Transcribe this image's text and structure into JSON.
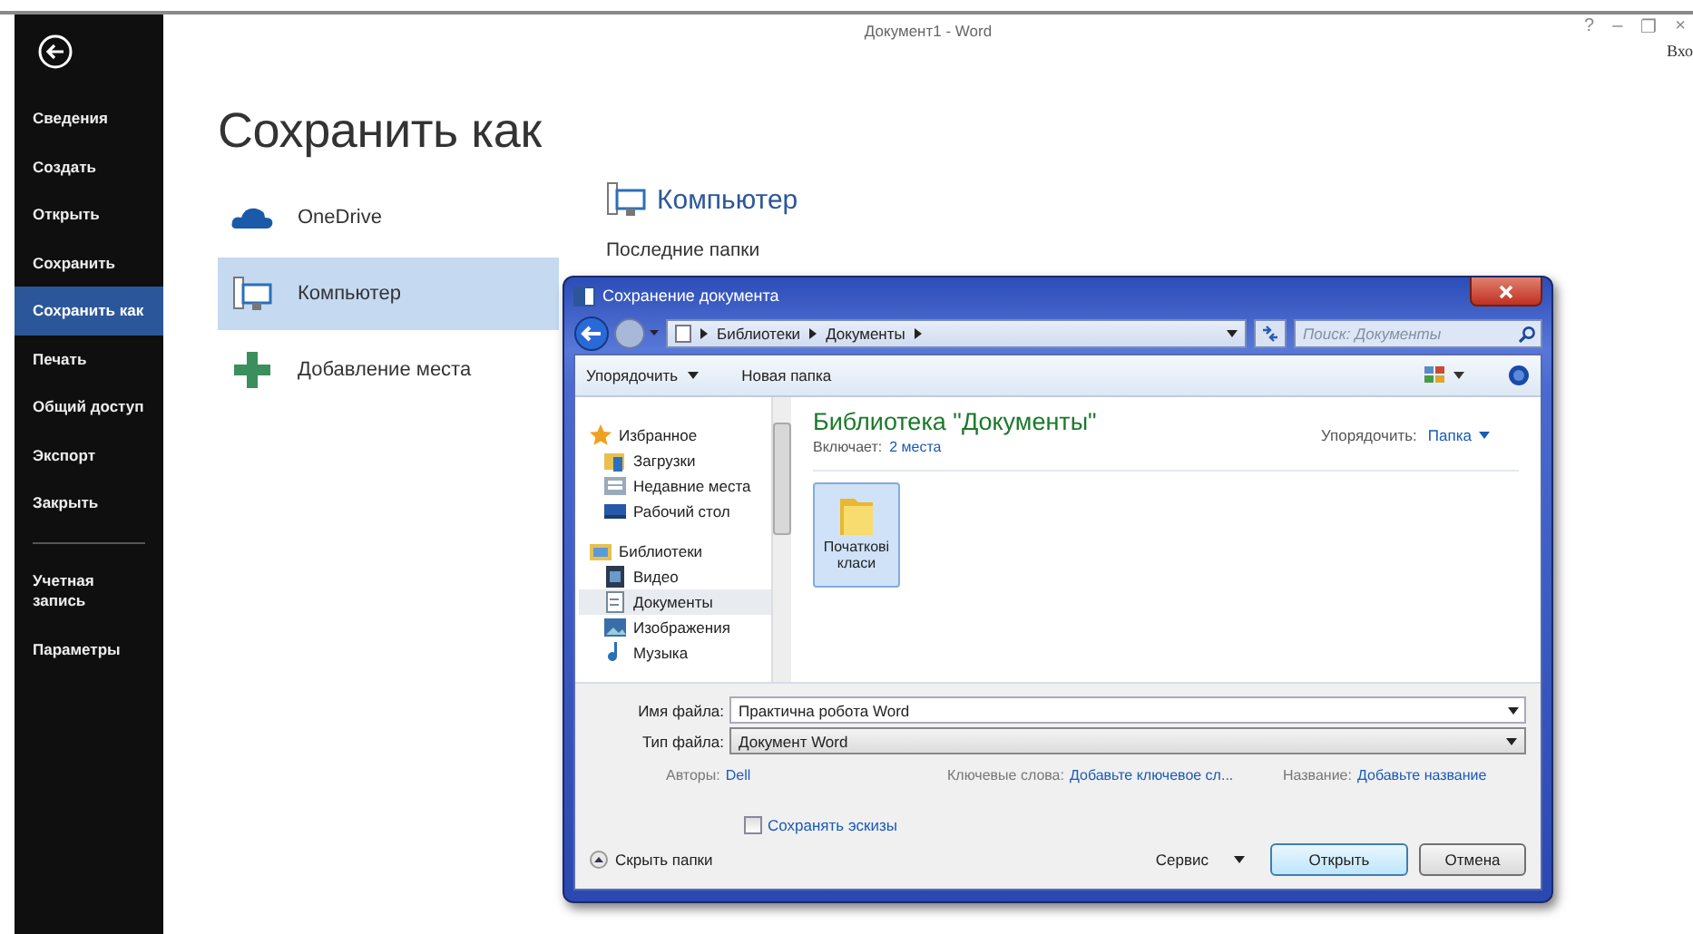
{
  "window": {
    "title": "Документ1 - Word",
    "controls": [
      "?",
      "–",
      "❐",
      "×"
    ],
    "sign_in": "Вхо"
  },
  "menu": [
    {
      "label": "Сведения",
      "selected": false
    },
    {
      "label": "Создать",
      "selected": false
    },
    {
      "label": "Открыть",
      "selected": false
    },
    {
      "label": "Сохранить",
      "selected": false
    },
    {
      "label": "Сохранить как",
      "selected": true
    },
    {
      "label": "Печать",
      "selected": false
    },
    {
      "label": "Общий доступ",
      "selected": false
    },
    {
      "label": "Экспорт",
      "selected": false
    },
    {
      "label": "Закрыть",
      "selected": false
    }
  ],
  "menu_bottom": [
    {
      "label": "Учетная запись",
      "selected": false
    },
    {
      "label": "Параметры",
      "selected": false
    }
  ],
  "heading": "Сохранить как",
  "places": [
    {
      "label": "OneDrive",
      "kind": "cloud",
      "selected": false
    },
    {
      "label": "Компьютер",
      "kind": "computer",
      "selected": true
    },
    {
      "label": "Добавление места",
      "kind": "plus",
      "selected": false
    }
  ],
  "location": {
    "title": "Компьютер",
    "recent_heading": "Последние папки"
  },
  "dialog": {
    "title": "Сохранение документа",
    "breadcrumb": [
      "Библиотеки",
      "Документы"
    ],
    "search_placeholder": "Поиск: Документы",
    "toolbar": {
      "organize": "Упорядочить",
      "new_folder": "Новая папка"
    },
    "nav": [
      {
        "label": "Избранное",
        "kind": "star",
        "selected": false,
        "children": [
          {
            "label": "Загрузки",
            "kind": "download",
            "selected": false
          },
          {
            "label": "Недавние места",
            "kind": "recent",
            "selected": false
          },
          {
            "label": "Рабочий стол",
            "kind": "desktop",
            "selected": false
          }
        ]
      },
      {
        "label": "Библиотеки",
        "kind": "library",
        "selected": false,
        "children": [
          {
            "label": "Видео",
            "kind": "video",
            "selected": false
          },
          {
            "label": "Документы",
            "kind": "document",
            "selected": true
          },
          {
            "label": "Изображения",
            "kind": "image",
            "selected": false
          },
          {
            "label": "Музыка",
            "kind": "music",
            "selected": false
          }
        ]
      }
    ],
    "library_title": "Библиотека \"Документы\"",
    "includes_label": "Включает:",
    "includes_link": "2 места",
    "arrange_label": "Упорядочить:",
    "arrange_value": "Папка",
    "items": [
      {
        "label": "Початкові класи",
        "selected": true
      }
    ],
    "file_name": {
      "label": "Имя файла:",
      "value": "Практична робота Word"
    },
    "file_type": {
      "label": "Тип файла:",
      "value": "Документ Word"
    },
    "meta": [
      {
        "label": "Авторы:",
        "value": "Dell"
      },
      {
        "label": "Ключевые слова:",
        "value": "Добавьте ключевое сл..."
      },
      {
        "label": "Название:",
        "value": "Добавьте название"
      }
    ],
    "thumbnails": {
      "label": "Сохранять эскизы",
      "checked": false
    },
    "hide_folders": "Скрыть папки",
    "tools": "Сервис",
    "buttons": [
      "Открыть",
      "Отмена"
    ]
  }
}
